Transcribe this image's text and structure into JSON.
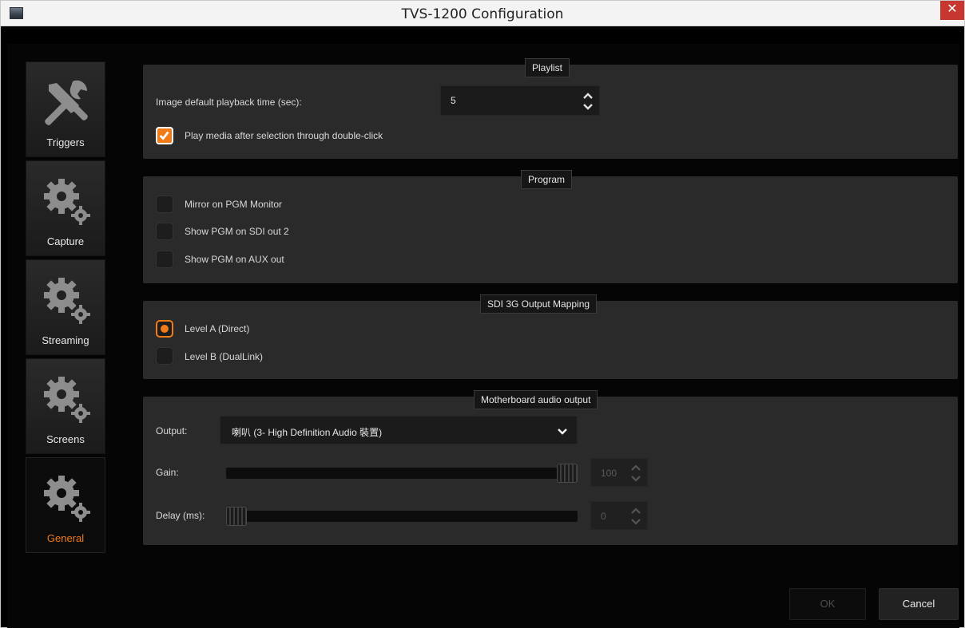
{
  "window": {
    "title": "TVS-1200 Configuration",
    "close_glyph": "✕"
  },
  "sidebar": {
    "items": [
      {
        "label": "Triggers",
        "icon": "tools-icon",
        "active": false
      },
      {
        "label": "Capture",
        "icon": "gears-icon",
        "active": false
      },
      {
        "label": "Streaming",
        "icon": "gears-icon",
        "active": false
      },
      {
        "label": "Screens",
        "icon": "gears-icon",
        "active": false
      },
      {
        "label": "General",
        "icon": "gears-icon",
        "active": true
      }
    ]
  },
  "playlist": {
    "title": "Playlist",
    "image_time_label": "Image default playback time (sec):",
    "image_time_value": "5",
    "double_click_label": "Play media after selection through double-click",
    "double_click_checked": true
  },
  "program": {
    "title": "Program",
    "options": [
      {
        "label": "Mirror on PGM Monitor",
        "checked": false
      },
      {
        "label": "Show PGM on SDI out 2",
        "checked": false
      },
      {
        "label": "Show PGM on AUX out",
        "checked": false
      }
    ]
  },
  "sdi": {
    "title": "SDI 3G Output Mapping",
    "options": [
      {
        "label": "Level A (Direct)",
        "selected": true
      },
      {
        "label": "Level B (DualLink)",
        "selected": false
      }
    ]
  },
  "audio": {
    "title": "Motherboard audio output",
    "output_label": "Output:",
    "output_value": "喇叭 (3- High Definition Audio 裝置)",
    "gain_label": "Gain:",
    "gain_value": "100",
    "gain_level": 1.0,
    "delay_label": "Delay (ms):",
    "delay_value": "0",
    "delay_level": 0.0
  },
  "buttons": {
    "ok": "OK",
    "cancel": "Cancel"
  },
  "colors": {
    "accent": "#f07b18",
    "panel": "#2a2a2a",
    "background": "#050505"
  }
}
